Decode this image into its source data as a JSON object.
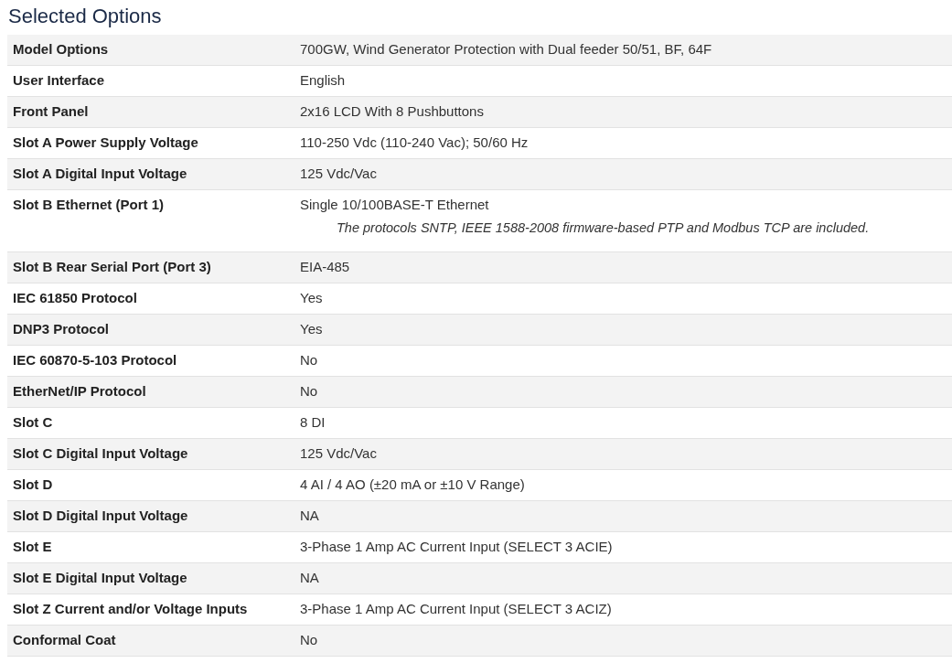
{
  "title": "Selected Options",
  "rows": [
    {
      "label": "Model Options",
      "value": "700GW, Wind Generator Protection with Dual feeder 50/51, BF, 64F"
    },
    {
      "label": "User Interface",
      "value": "English"
    },
    {
      "label": "Front Panel",
      "value": "2x16 LCD With 8 Pushbuttons"
    },
    {
      "label": "Slot A Power Supply Voltage",
      "value": "110-250 Vdc (110-240 Vac); 50/60 Hz"
    },
    {
      "label": "Slot A Digital Input Voltage",
      "value": "125 Vdc/Vac"
    },
    {
      "label": "Slot B Ethernet (Port 1)",
      "value": "Single 10/100BASE-T Ethernet",
      "note": "The protocols SNTP, IEEE 1588-2008 firmware-based PTP and  Modbus TCP are included."
    },
    {
      "label": "Slot B Rear Serial Port (Port 3)",
      "value": "EIA-485"
    },
    {
      "label": "IEC 61850 Protocol",
      "value": "Yes"
    },
    {
      "label": "DNP3 Protocol",
      "value": "Yes"
    },
    {
      "label": "IEC 60870-5-103 Protocol",
      "value": "No"
    },
    {
      "label": "EtherNet/IP Protocol",
      "value": "No"
    },
    {
      "label": "Slot C",
      "value": "8 DI"
    },
    {
      "label": "Slot C Digital Input Voltage",
      "value": "125 Vdc/Vac"
    },
    {
      "label": "Slot D",
      "value": "4 AI / 4 AO (±20 mA or ±10 V Range)"
    },
    {
      "label": "Slot D Digital Input Voltage",
      "value": "NA"
    },
    {
      "label": "Slot E",
      "value": "3-Phase 1 Amp AC Current Input (SELECT 3 ACIE)"
    },
    {
      "label": "Slot E Digital Input Voltage",
      "value": "NA"
    },
    {
      "label": "Slot Z Current and/or Voltage Inputs",
      "value": "3-Phase 1 Amp AC Current Input (SELECT 3 ACIZ)"
    },
    {
      "label": "Conformal Coat",
      "value": "No"
    }
  ]
}
